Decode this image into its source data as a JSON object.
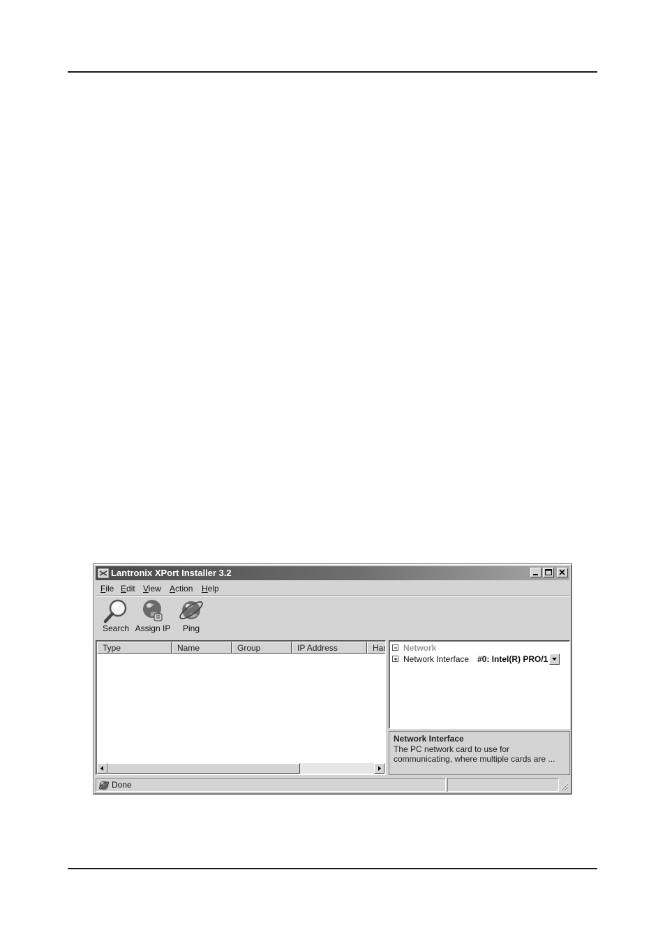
{
  "window": {
    "title": "Lantronix XPort Installer 3.2",
    "controls": [
      "minimize",
      "maximize",
      "close"
    ]
  },
  "menu": {
    "items": [
      {
        "label": "File",
        "accel": "F",
        "rest": "ile"
      },
      {
        "label": "Edit",
        "accel": "E",
        "rest": "dit"
      },
      {
        "label": "View",
        "accel": "V",
        "rest": "iew"
      },
      {
        "label": "Action",
        "accel": "A",
        "rest": "ction"
      },
      {
        "label": "Help",
        "accel": "H",
        "rest": "elp"
      }
    ]
  },
  "toolbar": {
    "search_label": "Search",
    "search_icon": "magnifier-icon",
    "assign_label": "Assign IP",
    "assign_icon": "globe-assign-icon",
    "ping_label": "Ping",
    "ping_icon": "globe-ping-icon"
  },
  "list": {
    "columns": [
      "Type",
      "Name",
      "Group",
      "IP Address",
      "Har"
    ],
    "rows": []
  },
  "properties": {
    "category": "Network",
    "row_label": "Network Interface",
    "row_value": "#0: Intel(R) PRO/1"
  },
  "description": {
    "title": "Network Interface",
    "line1": "The PC network card to use for",
    "line2": "communicating, where multiple cards are  ..."
  },
  "status": {
    "text": "Done",
    "icon": "globe-status-icon"
  }
}
